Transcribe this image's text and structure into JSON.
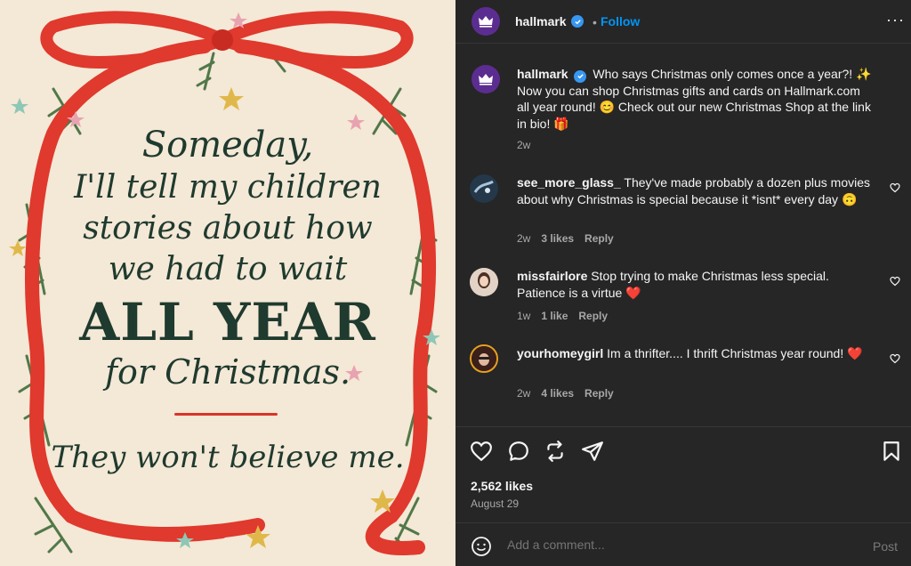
{
  "card": {
    "line1": "Someday,",
    "line2": "I'll tell my children",
    "line3": "stories about how",
    "line4": "we had to wait",
    "line5": "ALL YEAR",
    "line6": "for Christmas.",
    "line7": "They won't believe me."
  },
  "header": {
    "username": "hallmark",
    "separator": "•",
    "follow_label": "Follow",
    "more_label": "···"
  },
  "caption": {
    "username": "hallmark",
    "text": "Who says Christmas only comes once a year?! ✨ Now you can shop Christmas gifts and cards on Hallmark.com all year round! 😊 Check out our new Christmas Shop at the link in bio! 🎁",
    "time": "2w"
  },
  "comments": [
    {
      "username": "see_more_glass_",
      "text": "They've made probably a dozen plus movies about why Christmas is special because it *isnt* every day 🙃",
      "time": "2w",
      "likes": "3 likes",
      "reply": "Reply"
    },
    {
      "username": "missfairlore",
      "text": "Stop trying to make Christmas less special. Patience is a virtue ❤️",
      "time": "1w",
      "likes": "1 like",
      "reply": "Reply"
    },
    {
      "username": "yourhomeygirl",
      "text": "Im a thrifter.... I thrift Christmas year round! ❤️",
      "time": "2w",
      "likes": "4 likes",
      "reply": "Reply"
    }
  ],
  "footer": {
    "likes": "2,562 likes",
    "date": "August 29",
    "add_comment_placeholder": "Add a comment...",
    "post_label": "Post"
  },
  "colors": {
    "brand_purple": "#5c2d91",
    "verified_blue": "#3897f0",
    "follow_blue": "#0095f6",
    "ribbon_red": "#d9352a",
    "card_green": "#1f3a2e"
  }
}
